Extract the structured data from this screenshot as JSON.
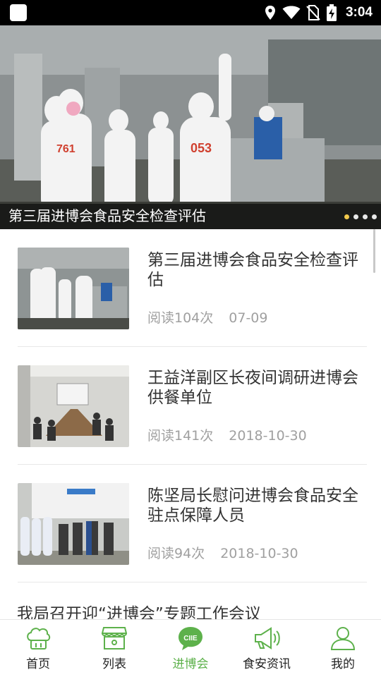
{
  "status_bar": {
    "time": "3:04"
  },
  "banner": {
    "caption": "第三届进博会食品安全检查评估",
    "jersey_numbers": [
      "761",
      "053"
    ],
    "dot_count": 4,
    "active_dot": 0
  },
  "articles": [
    {
      "title": "第三届进博会食品安全检查评估",
      "reads": "阅读104次",
      "date": "07-09"
    },
    {
      "title": "王益洋副区长夜间调研进博会供餐单位",
      "reads": "阅读141次",
      "date": "2018-10-30"
    },
    {
      "title": "陈坚局长慰问进博会食品安全驻点保障人员",
      "reads": "阅读94次",
      "date": "2018-10-30"
    }
  ],
  "partial_article": {
    "title": "我局召开迎“进博会”专题工作会议"
  },
  "nav": {
    "items": [
      {
        "label": "首页",
        "icon": "chef-hat-icon"
      },
      {
        "label": "列表",
        "icon": "store-icon"
      },
      {
        "label": "进博会",
        "icon": "ciie-icon",
        "icon_text": "CIIE"
      },
      {
        "label": "食安资讯",
        "icon": "megaphone-icon"
      },
      {
        "label": "我的",
        "icon": "user-icon"
      }
    ],
    "active_index": 2
  },
  "colors": {
    "accent": "#5db14b",
    "active_dot": "#f2c94c",
    "muted_text": "#a0a0a0"
  }
}
